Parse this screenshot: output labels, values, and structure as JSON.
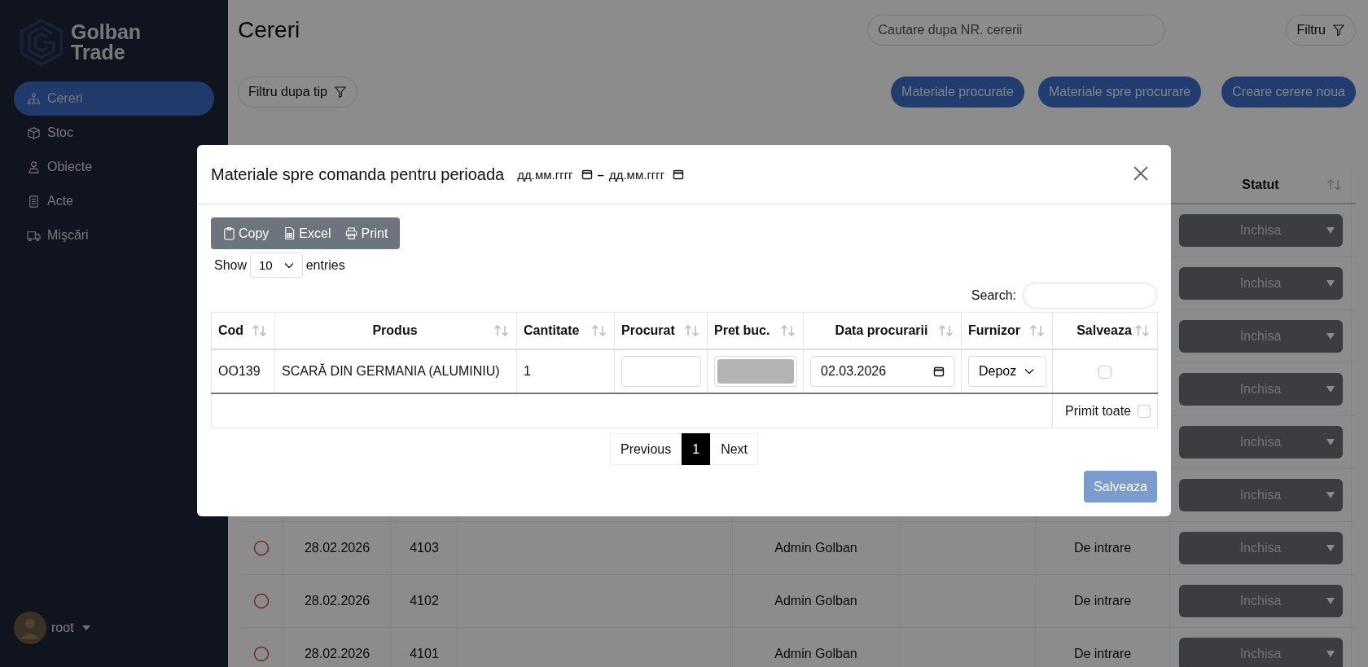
{
  "sidebar": {
    "logo": {
      "line1": "Golban",
      "line2": "Trade"
    },
    "items": [
      {
        "label": "Cereri",
        "selected": true
      },
      {
        "label": "Stoc",
        "selected": false
      },
      {
        "label": "Obiecte",
        "selected": false
      },
      {
        "label": "Acte",
        "selected": false
      },
      {
        "label": "Mişcări",
        "selected": false
      }
    ],
    "user": {
      "name": "root"
    }
  },
  "header": {
    "title": "Cereri",
    "search": {
      "placeholder": "Cautare dupa NR. cererii"
    },
    "filter_button": "Filtru",
    "type_filter_button": "Filtru dupa tip",
    "actions": [
      "Materiale procurate",
      "Materiale spre procurare",
      "Creare cerere noua"
    ]
  },
  "table": {
    "status_column": "Statut",
    "rows": [
      {
        "status": "Inchisa"
      },
      {
        "status": "Inchisa"
      },
      {
        "status": "Inchisa"
      },
      {
        "status": "Inchisa"
      },
      {
        "status": "Inchisa"
      },
      {
        "status": "Inchisa"
      },
      {
        "selected": false,
        "date": "28.02.2026",
        "number": "4103",
        "author": "Admin Golban",
        "type": "De intrare",
        "status": "Inchisa"
      },
      {
        "selected": false,
        "date": "28.02.2026",
        "number": "4102",
        "author": "Admin Golban",
        "type": "De intrare",
        "status": "Inchisa"
      },
      {
        "selected": false,
        "date": "28.02.2026",
        "number": "4101",
        "author": "Admin Golban",
        "type": "De intrare",
        "status": "Inchisa"
      }
    ]
  },
  "modal": {
    "title": "Materiale spre comanda pentru perioada",
    "date_from": {
      "placeholder": "дд.мм.гггг"
    },
    "separator": "–",
    "date_to": {
      "placeholder": "дд.мм.гггг"
    },
    "export_buttons": [
      "Copy",
      "Excel",
      "Print"
    ],
    "length": {
      "before": "Show",
      "value": "10",
      "after": "entries"
    },
    "search": {
      "label": "Search:"
    },
    "columns": [
      "Cod",
      "Produs",
      "Cantitate",
      "Procurat",
      "Pret buc.",
      "Data procurarii",
      "Furnizor",
      "Salveaza"
    ],
    "rows": [
      {
        "cod": "OO139",
        "produs": "SCARĂ DIN GERMANIA (ALUMINIU)",
        "cantitate": "1",
        "price_disabled": true,
        "date": "02.03.2026",
        "furnizor": "Depoz",
        "checked": false
      }
    ],
    "footer": {
      "label": "Primit toate",
      "checked": false
    },
    "pagination": [
      {
        "label": "Previous",
        "selected": false
      },
      {
        "label": "1",
        "selected": true
      },
      {
        "label": "Next",
        "selected": false
      }
    ],
    "save_button": {
      "label": "Salveaza",
      "disabled": true
    }
  }
}
